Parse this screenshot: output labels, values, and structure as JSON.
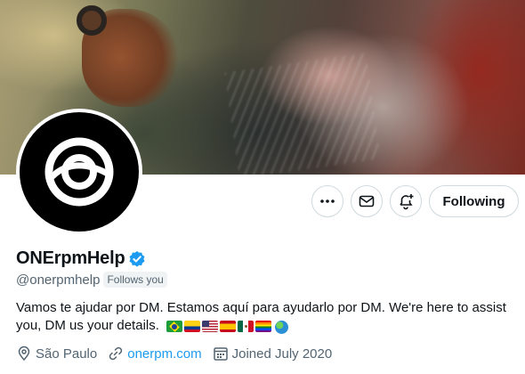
{
  "profile": {
    "display_name": "ONErpmHelp",
    "handle": "@onerpmhelp",
    "follows_you": "Follows you",
    "bio": "Vamos te ajudar por DM. Estamos aquí para ayudarlo por DM. We're here to assist you, DM us your details.",
    "bio_flags": [
      "brazil-flag",
      "colombia-flag",
      "usa-flag",
      "spain-flag",
      "mexico-flag",
      "rainbow-flag",
      "globe-icon"
    ],
    "location": "São Paulo",
    "website": "onerpm.com",
    "joined": "Joined July 2020"
  },
  "actions": {
    "more_icon": "more-icon",
    "message_icon": "mail-icon",
    "notify_icon": "bell-plus-icon",
    "following_label": "Following"
  },
  "colors": {
    "accent": "#1d9bf0",
    "secondary_text": "#536471",
    "border": "#cfd9de"
  }
}
